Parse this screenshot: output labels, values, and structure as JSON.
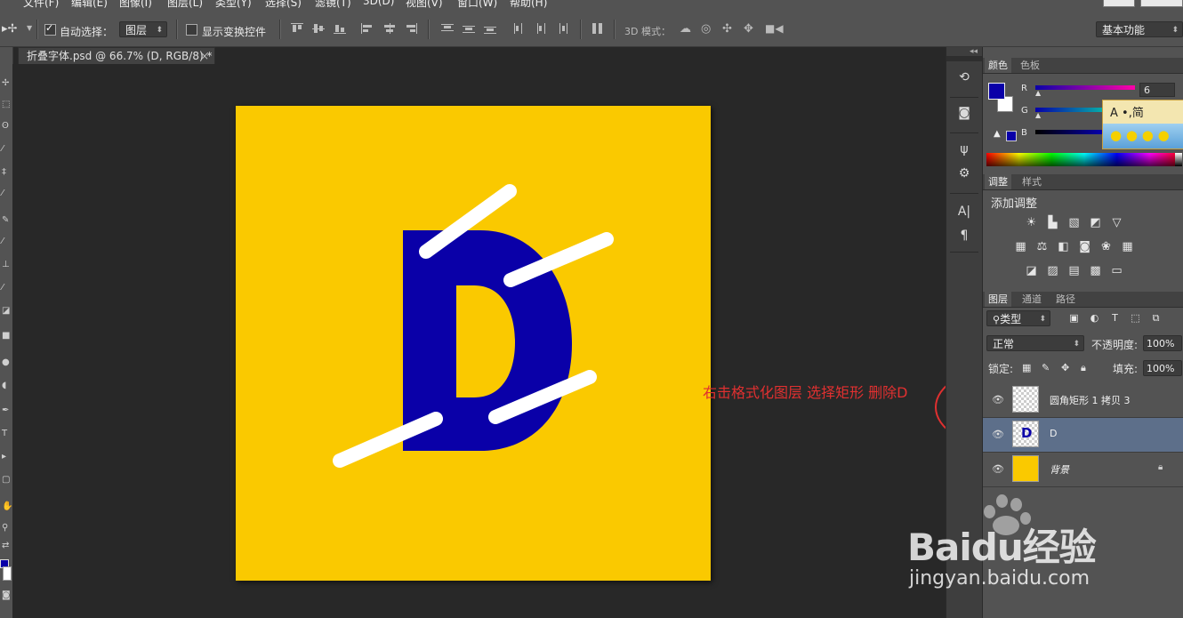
{
  "menubar": {
    "items": [
      "文件(F)",
      "编辑(E)",
      "图像(I)",
      "图层(L)",
      "类型(Y)",
      "选择(S)",
      "滤镜(T)",
      "3D(D)",
      "视图(V)",
      "窗口(W)",
      "帮助(H)"
    ]
  },
  "options": {
    "auto_select_label": "自动选择：",
    "auto_select_target": "图层",
    "show_transform_label": "显示变换控件",
    "mode_3d_label": "3D 模式：",
    "workspace": "基本功能"
  },
  "document": {
    "tab_title": "折叠字体.psd @ 66.7% (D, RGB/8) *",
    "close_glyph": "×",
    "canvas_color": "#fac900",
    "letter": "D",
    "letter_color": "#0a00a8",
    "annotation": "右击格式化图层 选择矩形 删除D"
  },
  "color_panel": {
    "tabs": [
      "颜色",
      "色板"
    ],
    "channels": [
      "R",
      "G",
      "B"
    ],
    "r_value": "6",
    "foreground": "#0a00a8",
    "background": "#ffffff",
    "ime_text": "A •,简"
  },
  "adjust_panel": {
    "tabs": [
      "调整",
      "样式"
    ],
    "title": "添加调整"
  },
  "layers_panel": {
    "tabs": [
      "图层",
      "通道",
      "路径"
    ],
    "filter_kind": "类型",
    "blend_mode": "正常",
    "opacity_label": "不透明度:",
    "opacity_value": "100%",
    "lock_label": "锁定:",
    "fill_label": "填充:",
    "fill_value": "100%",
    "layers": [
      {
        "name": "圆角矩形 1 拷贝 3",
        "selected": false
      },
      {
        "name": "D",
        "selected": true
      },
      {
        "name": "背景",
        "selected": false
      }
    ]
  },
  "watermark": {
    "brand": "Baidu经验",
    "url": "jingyan.baidu.com"
  }
}
